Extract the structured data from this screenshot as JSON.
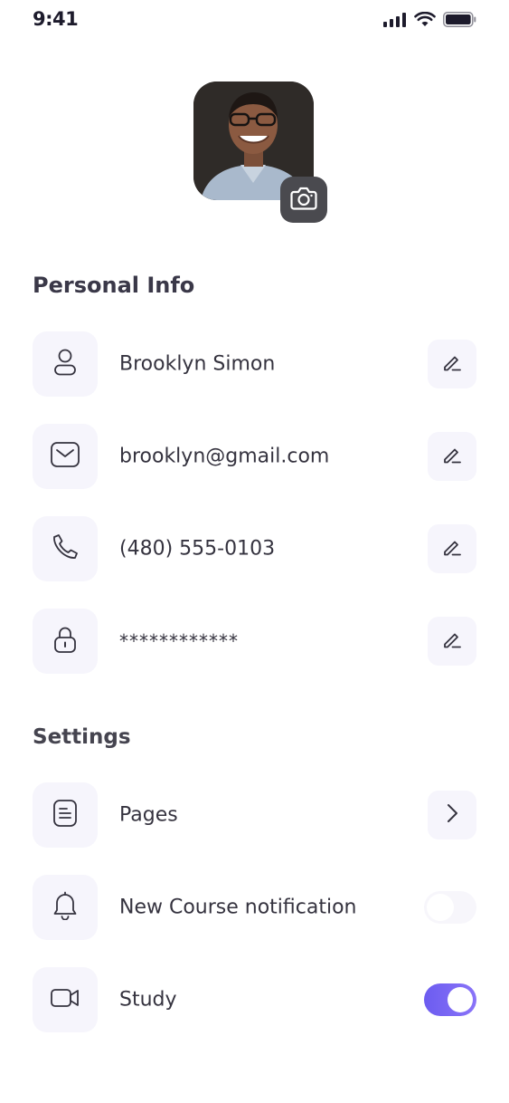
{
  "status_bar": {
    "time": "9:41"
  },
  "profile": {
    "avatar_alt": "profile photo"
  },
  "personal_info": {
    "title": "Personal Info",
    "rows": [
      {
        "icon": "user-icon",
        "value": "Brooklyn Simon",
        "action": "edit-icon"
      },
      {
        "icon": "mail-icon",
        "value": "brooklyn@gmail.com",
        "action": "edit-icon"
      },
      {
        "icon": "phone-icon",
        "value": "(480) 555-0103",
        "action": "edit-icon"
      },
      {
        "icon": "lock-icon",
        "value": "************",
        "action": "edit-icon"
      }
    ]
  },
  "settings": {
    "title": "Settings",
    "rows": [
      {
        "icon": "pages-icon",
        "label": "Pages",
        "control": "chevron"
      },
      {
        "icon": "bell-icon",
        "label": "New Course notification",
        "control": "toggle",
        "on": false
      },
      {
        "icon": "video-icon",
        "label": "Study",
        "control": "toggle",
        "on": true
      }
    ]
  },
  "colors": {
    "accent": "#6f5ff2",
    "icon_bg": "#f6f5fc",
    "text": "#35333f"
  }
}
